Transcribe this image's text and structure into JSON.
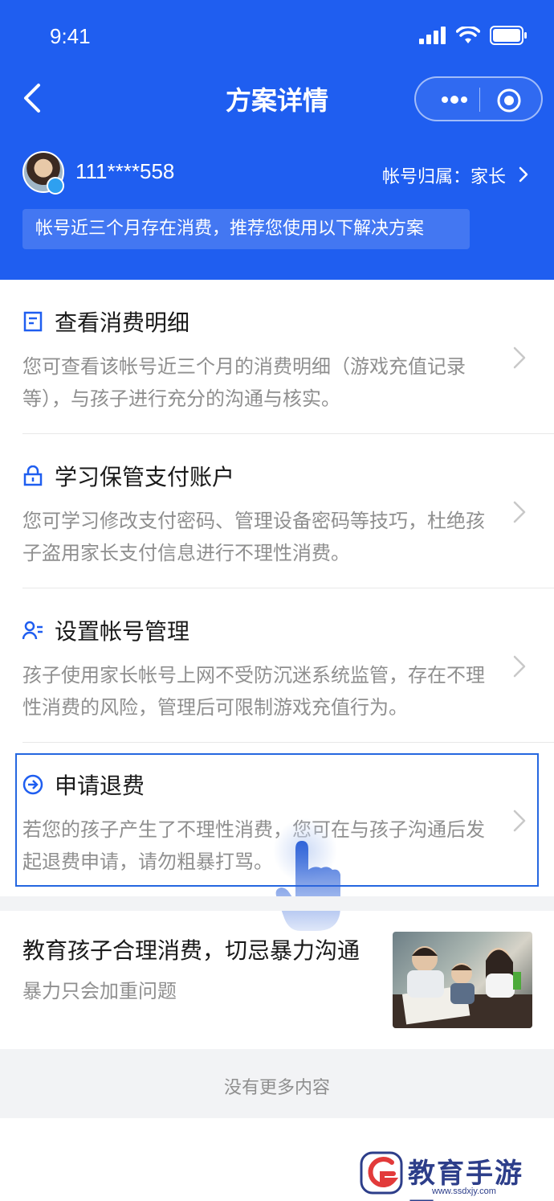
{
  "status_bar": {
    "time": "9:41"
  },
  "nav": {
    "title": "方案详情"
  },
  "account": {
    "id": "111****558",
    "owner": "帐号归属：家长"
  },
  "banner": "帐号近三个月存在消费，推荐您使用以下解决方案",
  "items": [
    {
      "title": "查看消费明细",
      "icon": "document-icon",
      "desc": "您可查看该帐号近三个月的消费明细（游戏充值记录等），与孩子进行充分的沟通与核实。"
    },
    {
      "title": "学习保管支付账户",
      "icon": "lock-icon",
      "desc": "您可学习修改支付密码、管理设备密码等技巧，杜绝孩子盗用家长支付信息进行不理性消费。"
    },
    {
      "title": "设置帐号管理",
      "icon": "user-manage-icon",
      "desc": "孩子使用家长帐号上网不受防沉迷系统监管，存在不理性消费的风险，管理后可限制游戏充值行为。"
    },
    {
      "title": "申请退费",
      "icon": "arrow-circle-icon",
      "desc": "若您的孩子产生了不理性消费，您可在与孩子沟通后发起退费申请，请勿粗暴打骂。"
    }
  ],
  "article": {
    "title": "教育孩子合理消费，切忌暴力沟通",
    "subtitle": "暴力只会加重问题"
  },
  "footer": "没有更多内容",
  "watermark": {
    "name": "教育手游网",
    "url": "www.ssdxjy.com"
  },
  "colors": {
    "primary": "#1f5ef0",
    "highlight_border": "#2567e0",
    "text": "#1a1a1a",
    "muted": "#8f8f8f"
  }
}
